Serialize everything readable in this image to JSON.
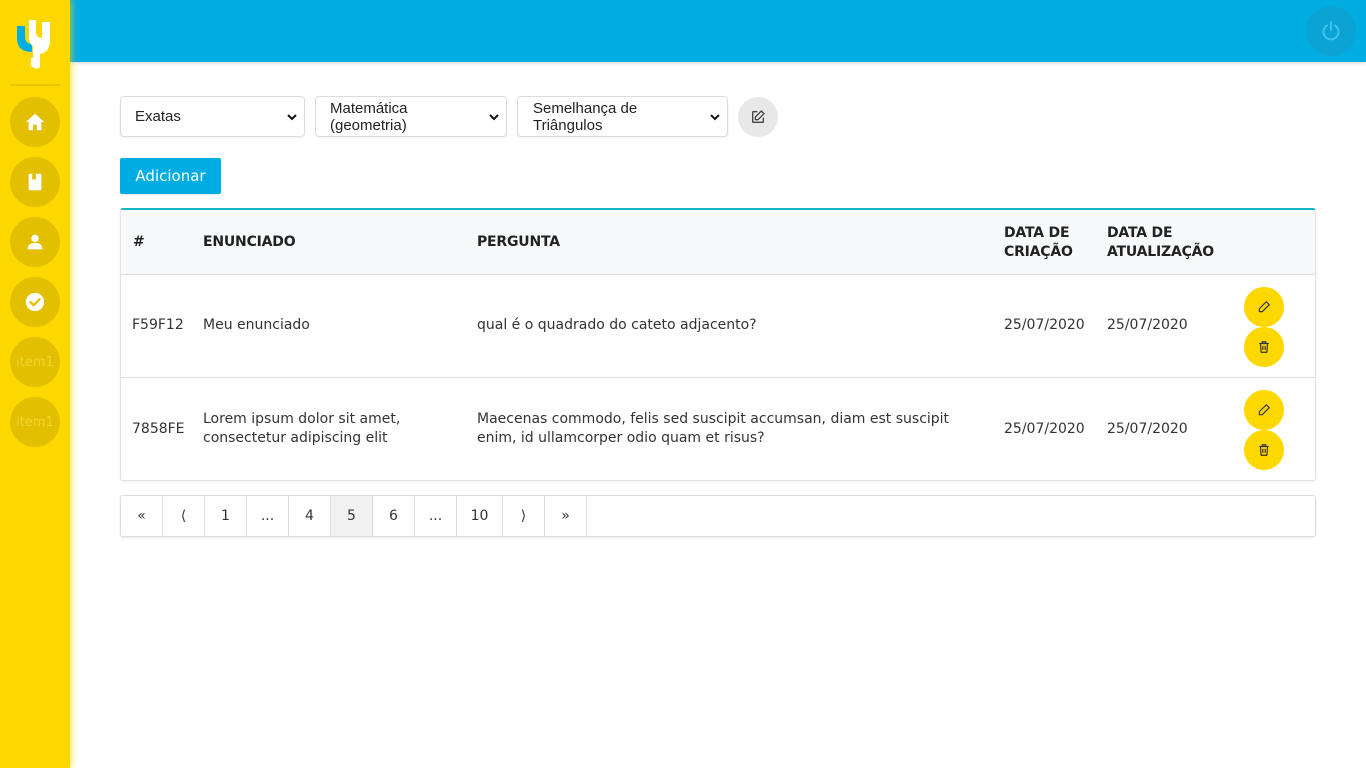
{
  "colors": {
    "accent_yellow": "#fcd700",
    "accent_blue": "#00ade3",
    "table_top_border": "#16b3c4"
  },
  "sidebar": {
    "logo": "yu-logo-icon",
    "items": [
      {
        "icon": "home-icon",
        "label": ""
      },
      {
        "icon": "book-icon",
        "label": ""
      },
      {
        "icon": "user-icon",
        "label": ""
      },
      {
        "icon": "check-circle-icon",
        "label": ""
      },
      {
        "icon": "",
        "label": "item1"
      },
      {
        "icon": "",
        "label": "item1"
      }
    ]
  },
  "topbar": {
    "power_icon": "power-icon"
  },
  "filters": {
    "area": "Exatas",
    "subject": "Matemática (geometria)",
    "topic": "Semelhança de Triângulos",
    "edit_icon": "edit-icon"
  },
  "add_button": "Adicionar",
  "table": {
    "headers": {
      "id": "#",
      "statement": "ENUNCIADO",
      "question": "PERGUNTA",
      "created_line1": "DATA DE",
      "created_line2": "CRIAÇÃO",
      "updated_line1": "DATA DE",
      "updated_line2": "ATUALIZAÇÃO"
    },
    "rows": [
      {
        "id": "F59F12",
        "statement": "Meu enunciado",
        "question": "qual é o quadrado do cateto adjacento?",
        "created": "25/07/2020",
        "updated": "25/07/2020"
      },
      {
        "id": "7858FE",
        "statement": "Lorem ipsum dolor sit amet, consectetur adipiscing elit",
        "question": "Maecenas commodo, felis sed suscipit accumsan, diam est suscipit enim, id ullamcorper odio quam et risus?",
        "created": "25/07/2020",
        "updated": "25/07/2020"
      }
    ]
  },
  "pagination": {
    "pages": [
      "«",
      "⟨",
      "1",
      "...",
      "4",
      "5",
      "6",
      "...",
      "10",
      "⟩",
      "»"
    ],
    "active": "5"
  }
}
